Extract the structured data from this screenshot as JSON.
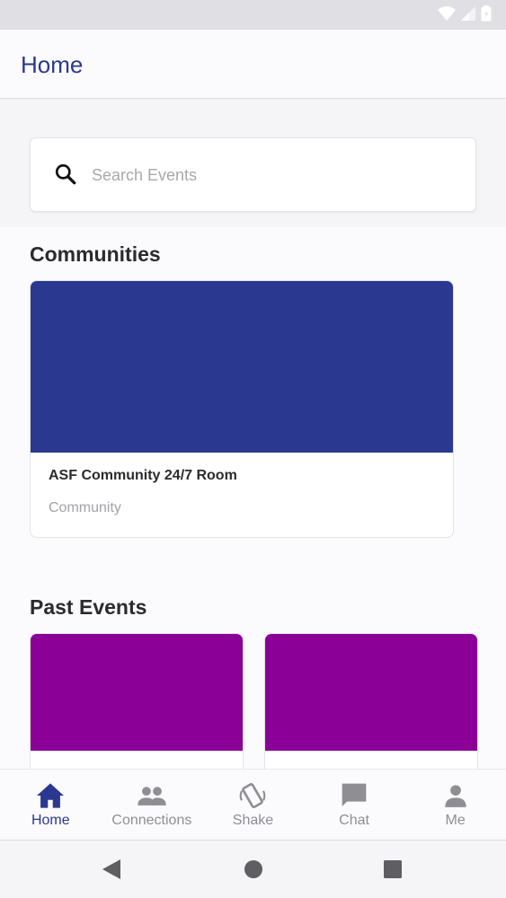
{
  "app": {
    "title": "Home"
  },
  "search": {
    "placeholder": "Search Events"
  },
  "sections": {
    "communities_title": "Communities",
    "past_events_title": "Past Events"
  },
  "communities": [
    {
      "name": "ASF Community 24/7 Room",
      "type": "Community",
      "banner_color": "#2b388f"
    }
  ],
  "past_events": [
    {
      "banner_color": "#8b0096"
    },
    {
      "banner_color": "#8b0096"
    }
  ],
  "bottom_nav": {
    "items": [
      {
        "label": "Home",
        "icon": "home-icon",
        "active": true
      },
      {
        "label": "Connections",
        "icon": "people-icon",
        "active": false
      },
      {
        "label": "Shake",
        "icon": "shake-phone-icon",
        "active": false
      },
      {
        "label": "Chat",
        "icon": "chat-icon",
        "active": false
      },
      {
        "label": "Me",
        "icon": "person-icon",
        "active": false
      }
    ]
  },
  "colors": {
    "accent": "#2b388f",
    "event_banner": "#8b0096",
    "inactive": "#8f8e93"
  }
}
